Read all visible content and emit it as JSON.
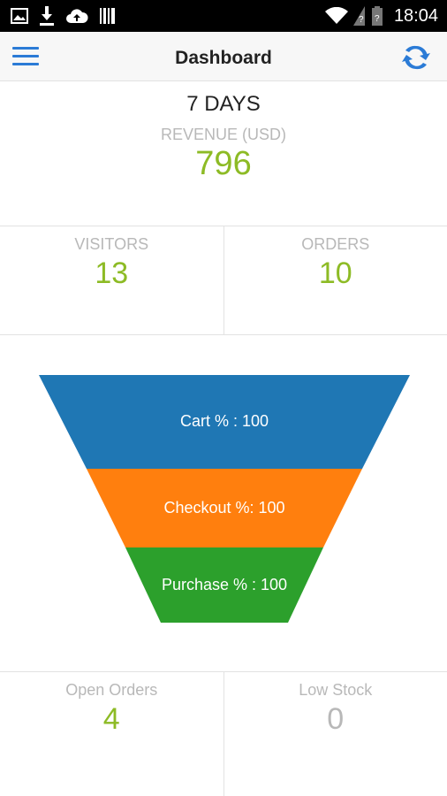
{
  "statusbar": {
    "time": "18:04",
    "left_icons": [
      "image-icon",
      "download-icon",
      "cloud-upload-icon",
      "barcode-icon"
    ],
    "right_icons": [
      "wifi-icon",
      "signal-icon",
      "battery-icon"
    ]
  },
  "appbar": {
    "title": "Dashboard",
    "menu_icon": "menu-icon",
    "refresh_icon": "refresh-icon",
    "accent": "#2b7bd6"
  },
  "summary": {
    "period": "7 DAYS",
    "revenue_label": "REVENUE (USD)",
    "revenue_value": "796",
    "value_color": "#8dbb25"
  },
  "stats_top": {
    "visitors_label": "VISITORS",
    "visitors_value": "13",
    "orders_label": "ORDERS",
    "orders_value": "10"
  },
  "funnel": {
    "stages": [
      {
        "label": "Cart % : 100",
        "color": "#1f77b4"
      },
      {
        "label": "Checkout %: 100",
        "color": "#ff7f0e"
      },
      {
        "label": "Purchase % : 100",
        "color": "#2ca02c"
      }
    ]
  },
  "stats_bottom": {
    "open_orders_label": "Open Orders",
    "open_orders_value": "4",
    "low_stock_label": "Low Stock",
    "low_stock_value": "0"
  }
}
